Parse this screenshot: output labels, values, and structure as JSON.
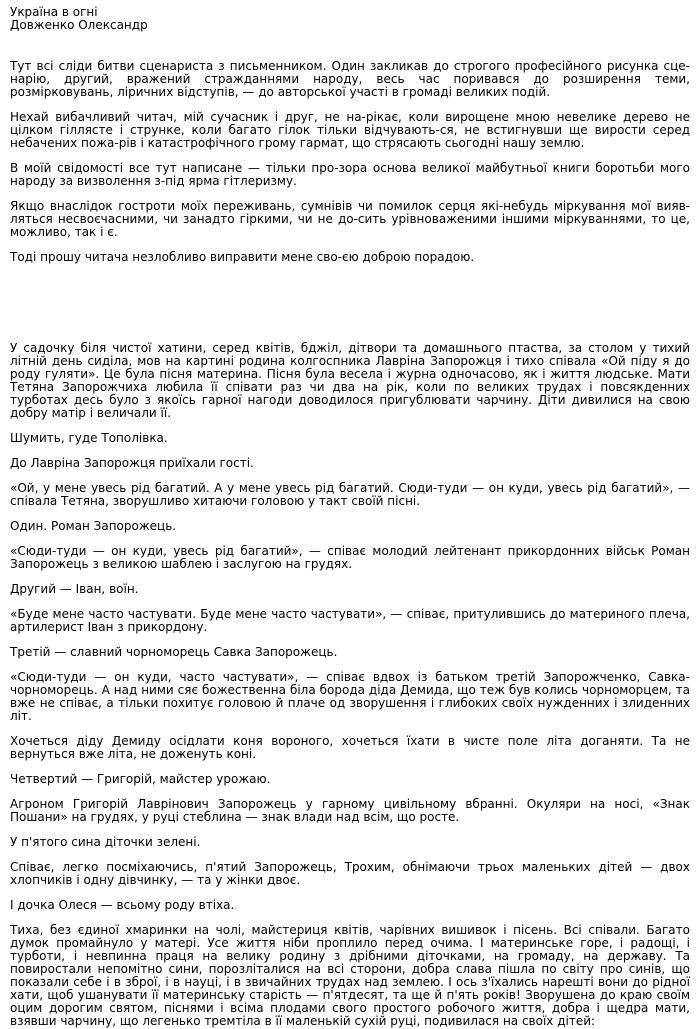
{
  "header": {
    "title": "Україна в огні",
    "author": "Довженко Олександр"
  },
  "preface": [
    "Тут всі сліди битви сценариста з письменником. Один закликав до строгого професійного рисунка сце-нарію, другий, вражений стражданнями народу, весь час поривався до розширення теми, розмірковувань, ліричних відступів, — до авторської участі в громаді великих подій.",
    "Нехай вибачливий читач, мій сучасник і друг, не на-рікає, коли вирощене мною невелике дерево не цілком гіллясте і струнке, коли багато гілок тільки відчувають-ся, не встигнувши ще вирости серед небачених пожа-рів і катастрофічного грому гармат, що стрясають сьогодні нашу землю.",
    "В моїй свідомості все тут написане — тільки про-зора основа великої майбутньої книги боротьби мого народу за визволення з-під ярма гітлеризму.",
    "Якщо внаслідок гостроти моїх переживань, сумнівів чи помилок серця які-небудь міркування мої вияв-ляться несвоєчасними, чи занадто гіркими, чи не до-сить урівноваженими іншими міркуваннями, то це, можливо, так і є.",
    "Тоді прошу читача незлобливо виправити мене сво-єю доброю порадою."
  ],
  "body": [
    "У садочку біля чистої хатини, серед квітів, бджіл, дітвори та домашнього птаства, за столом у тихий літній день сиділа, мов на картині родина колгоспника Лавріна Запорожця і тихо співала «Ой піду я до роду гуляти». Це була пісня материна. Пісня була весела і журна одночасово, як і життя людське. Мати Тетяна Запорожчиха любила її співати раз чи два на рік, коли по великих трудах і повсякденних турботах десь було з якоїсь гарної нагоди доводилося пригублювати чарчину. Діти дивилися на свою добру матір і величали її.",
    "Шумить, гуде Тополівка.",
    "До Лавріна Запорожця приїхали гості.",
    "«Ой, у мене увесь рід багатий. А у мене увесь рід багатий. Сюди-туди — он куди, увесь рід багатий», — співала Тетяна, зворушливо хитаючи головою у такт своїй пісні.",
    "Один. Роман Запорожець.",
    "«Сюди-туди — он куди, увесь рід багатий», — співає молодий лейтенант прикордонних військ Роман Запорожець з великою шаблею і заслугою на грудях.",
    "Другий — Іван, воїн.",
    "«Буде мене часто частувати. Буде мене часто частувати», — співає, притулившись до материного плеча, артилерист Іван з прикордону.",
    "Третій — славний чорноморець Савка Запорожець.",
    "«Сюди-туди — он куди, часто частувати», — співає вдвох із батьком третій Запорожченко, Савка-чорноморець. А над ними сяє божественна біла борода діда Демида, що теж був колись чорноморцем, та вже не співає, а тільки похитує головою й плаче од зворушення і глибоких своїх нужденних і злиденних літ.",
    "Хочеться діду Демиду осідлати коня вороного, хочеться їхати в чисте поле літа доганяти. Та не вернуться вже літа, не доженуть коні.",
    "Четвертий — Григорій, майстер урожаю.",
    "Агроном Григорій Лаврінович Запорожець у гарному цивільному вбранні. Окуляри на носі, «Знак Пошани» на грудях, у руці стеблина — знак влади над всім, що росте.",
    "У п'ятого сина діточки зелені.",
    "Співає, легко посміхаючись, п'ятий Запорожець, Трохим, обнімаючи трьох маленьких дітей — двох хлопчиків і одну дівчинку, — та у жінки двоє.",
    "І дочка Олеся — всьому роду втіха.",
    "Тиха, без єдиної хмаринки на чолі, майстериця квітів, чарівних вишивок і пісень. Всі співали. Багато думок промайнуло у матері. Усе життя ніби проплило перед очима. І материнське горе, і радощі, і турботи, і невпинна праця на велику родину з дрібними діточками, на громаду, на державу. Та повиростали непомітно сини, порозліталися на всі сторони, добра слава пішла по світу про синів, що показали себе і в зброї, і в науці, і в звичайних трудах над землею. І ось з'їхались нарешті вони до рідної хати, щоб ушанувати її материнську старість — п'ятдесят, та ще й п'ять років! Зворушена до краю своїм оцим дорогим святом, піснями і всіма плодами свого простого робочого життя, добра і щедра мати, взявши чарчину, що легенько тремтіла в її маленькій сухій руці, подивилася на своїх дітей:"
  ]
}
